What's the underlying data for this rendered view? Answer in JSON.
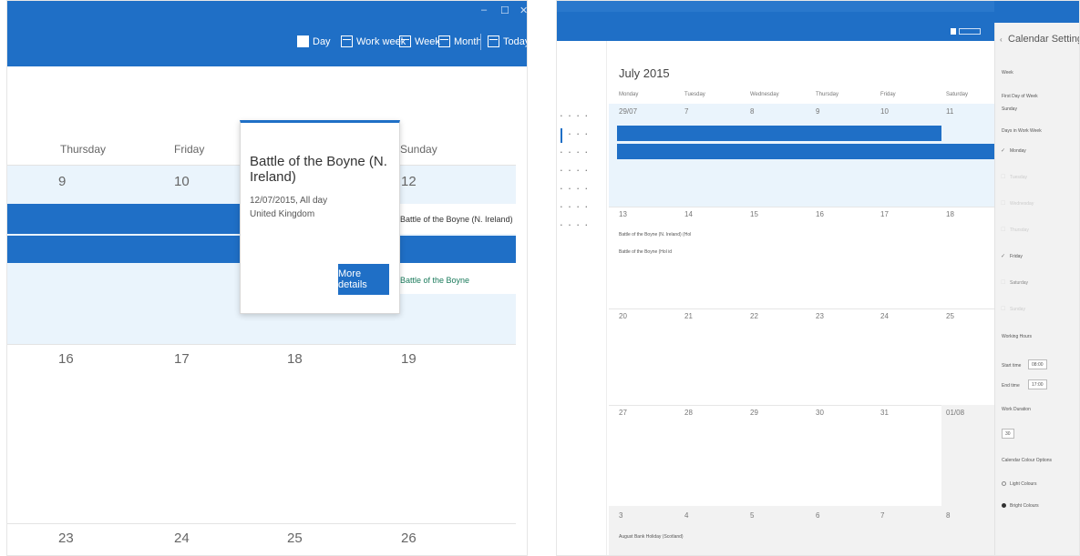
{
  "left_window": {
    "window_controls": [
      "–",
      "☐",
      "✕"
    ],
    "views": [
      {
        "label": "Day"
      },
      {
        "label": "Work week"
      },
      {
        "label": "Week"
      },
      {
        "label": "Month"
      },
      {
        "label": "Today"
      }
    ],
    "day_headers": [
      "Thursday",
      "Friday",
      "Sunday"
    ],
    "week_rows": [
      [
        "9",
        "10",
        "12"
      ],
      [
        "16",
        "17",
        "18",
        "19"
      ],
      [
        "23",
        "24",
        "25",
        "26"
      ]
    ],
    "events": [
      "Battle of the Boyne (N. Ireland)",
      "Battle of the Boyne"
    ],
    "popup": {
      "title": "Battle of the Boyne (N. Ireland)",
      "date": "12/07/2015, All day",
      "location": "United Kingdom",
      "more_label": "More details"
    },
    "colors": {
      "accent": "#1f6fc6",
      "selected_row": "#e8f3fc"
    }
  },
  "right_window": {
    "month_title": "July 2015",
    "day_headers": [
      "Monday",
      "Tuesday",
      "Wednesday",
      "Thursday",
      "Friday",
      "Saturday"
    ],
    "rows": [
      [
        "29/07",
        "7",
        "8",
        "9",
        "10",
        "11"
      ],
      [
        "13",
        "14",
        "15",
        "16",
        "17",
        "18"
      ],
      [
        "20",
        "21",
        "22",
        "23",
        "24",
        "25"
      ],
      [
        "27",
        "28",
        "29",
        "30",
        "31",
        "01/08"
      ],
      [
        "3",
        "4",
        "5",
        "6",
        "7",
        "8"
      ]
    ],
    "events": [
      "Battle of the Boyne (N. Ireland) (Hol",
      "Battle of the Boyne (Hol id",
      "August Bank Holiday (Scotland)"
    ],
    "settings": {
      "title": "Calendar Settings",
      "week_label": "Week",
      "first_day_label": "First Day of Week",
      "first_day_value": "Sunday",
      "days_label": "Days in Work Week",
      "days": [
        {
          "label": "Monday",
          "on": true
        },
        {
          "label": "Tuesday",
          "on": false
        },
        {
          "label": "Wednesday",
          "on": false
        },
        {
          "label": "Thursday",
          "on": false
        },
        {
          "label": "Friday",
          "on": true
        },
        {
          "label": "Saturday",
          "on": false
        },
        {
          "label": "Sunday",
          "on": false
        }
      ],
      "working_hours_label": "Working Hours",
      "start_label": "Start time",
      "start_value": "08:00",
      "end_label": "End time",
      "end_value": "17:00",
      "duration_label": "Work Duration",
      "duration_value": "30",
      "colour_label": "Calendar Colour Options",
      "colour_options": [
        {
          "label": "Light Colours",
          "selected": false
        },
        {
          "label": "Bright Colours",
          "selected": true
        }
      ]
    }
  }
}
